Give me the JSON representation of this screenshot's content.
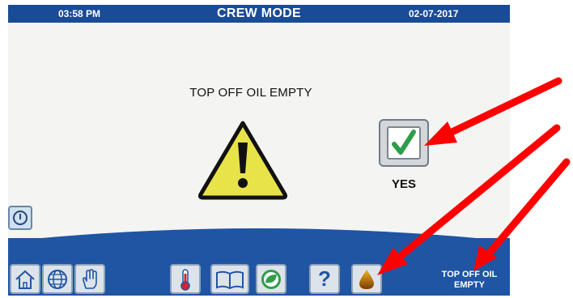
{
  "header": {
    "time": "03:58 PM",
    "mode": "CREW MODE",
    "date": "02-07-2017"
  },
  "main": {
    "message": "TOP OFF OIL EMPTY",
    "confirm_label": "YES"
  },
  "footer": {
    "status_line1": "TOP OFF OIL",
    "status_line2": "EMPTY",
    "nav": [
      "home-icon",
      "globe-icon",
      "hand-icon",
      "thermometer-icon",
      "book-icon",
      "leaf-icon",
      "help-icon",
      "oil-drop-icon"
    ],
    "help_glyph": "?"
  },
  "colors": {
    "header_bar": "#1a4b96",
    "footer_bar": "#1f55a3",
    "warning_yellow": "#e9e34a",
    "check_green": "#2e9d4a",
    "annotation_arrow": "#ff0000"
  }
}
